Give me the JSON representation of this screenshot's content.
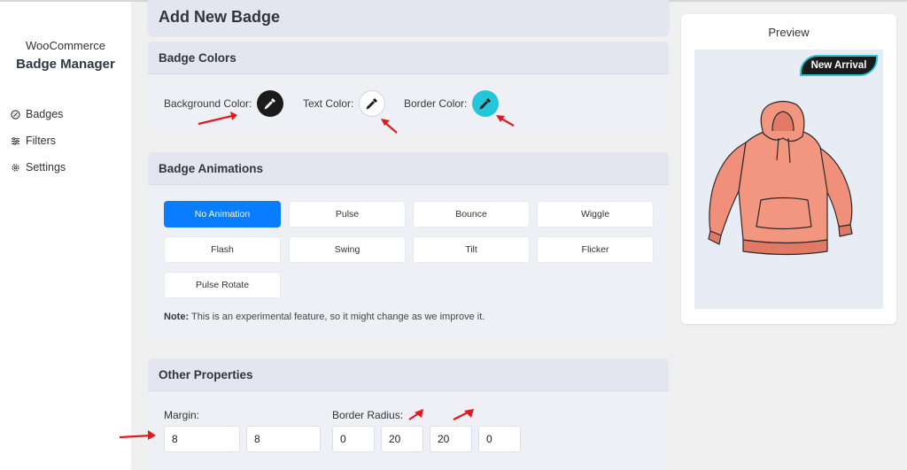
{
  "sidebar": {
    "brand_top": "WooCommerce",
    "brand_main": "Badge Manager",
    "items": [
      {
        "label": "Badges",
        "icon": "badge-icon"
      },
      {
        "label": "Filters",
        "icon": "filters-icon"
      },
      {
        "label": "Settings",
        "icon": "gear-icon"
      }
    ]
  },
  "page": {
    "title": "Add New Badge"
  },
  "badge_colors": {
    "header": "Badge Colors",
    "background": {
      "label": "Background Color:",
      "value": "#1b1b1b"
    },
    "text": {
      "label": "Text Color:",
      "value": "#ffffff"
    },
    "border": {
      "label": "Border Color:",
      "value": "#26c6da"
    }
  },
  "animations": {
    "header": "Badge Animations",
    "options": [
      "No Animation",
      "Pulse",
      "Bounce",
      "Wiggle",
      "Flash",
      "Swing",
      "Tilt",
      "Flicker",
      "Pulse Rotate"
    ],
    "selected": "No Animation",
    "note_bold": "Note:",
    "note_text": "This is an experimental feature, so it might change as we improve it."
  },
  "other": {
    "header": "Other Properties",
    "margin_label": "Margin:",
    "margin": [
      "8",
      "8"
    ],
    "radius_label": "Border Radius:",
    "radius": [
      "0",
      "20",
      "20",
      "0"
    ]
  },
  "preview": {
    "title": "Preview",
    "badge_text": "New Arrival",
    "product_icon": "hoodie-image"
  },
  "colors": {
    "accent": "#0a7cff",
    "annotation_arrow": "#e01b1b",
    "hoodie": "#f0907a"
  }
}
